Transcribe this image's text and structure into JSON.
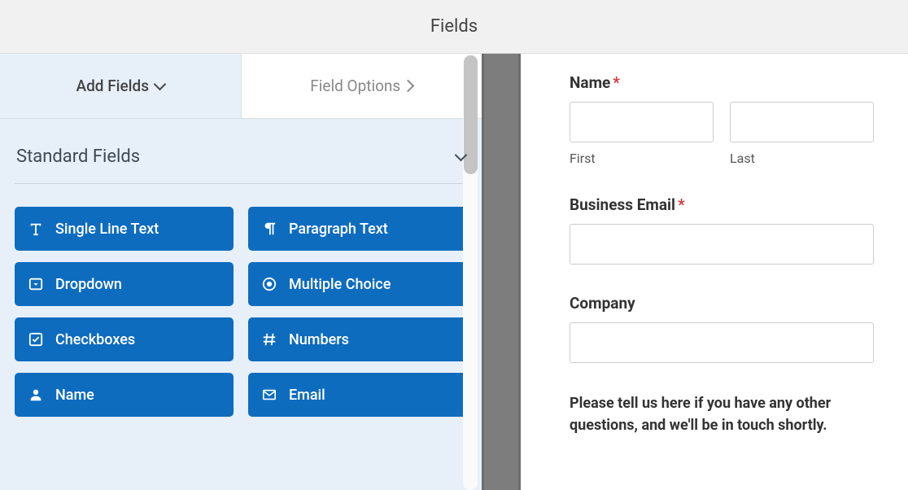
{
  "header": {
    "title": "Fields"
  },
  "tabs": {
    "add_fields": "Add Fields",
    "field_options": "Field Options"
  },
  "sections": {
    "standard": {
      "title": "Standard Fields",
      "fields": [
        {
          "icon": "text-icon",
          "label": "Single Line Text"
        },
        {
          "icon": "paragraph-icon",
          "label": "Paragraph Text"
        },
        {
          "icon": "dropdown-icon",
          "label": "Dropdown"
        },
        {
          "icon": "radio-icon",
          "label": "Multiple Choice"
        },
        {
          "icon": "checkbox-icon",
          "label": "Checkboxes"
        },
        {
          "icon": "hash-icon",
          "label": "Numbers"
        },
        {
          "icon": "user-icon",
          "label": "Name"
        },
        {
          "icon": "envelope-icon",
          "label": "Email"
        }
      ]
    }
  },
  "preview": {
    "name": {
      "label": "Name",
      "required": true,
      "first": "First",
      "last": "Last"
    },
    "email": {
      "label": "Business Email",
      "required": true
    },
    "company": {
      "label": "Company",
      "required": false
    },
    "hint": "Please tell us here if you have any other questions, and we'll be in touch shortly."
  }
}
